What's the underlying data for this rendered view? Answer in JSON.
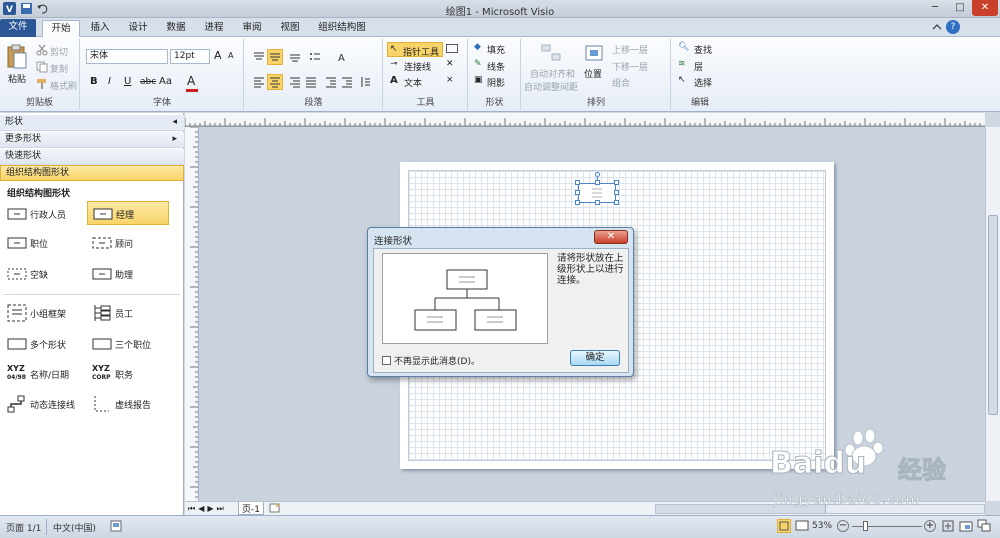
{
  "app": {
    "title": "绘图1 - Microsoft Visio"
  },
  "tabs": [
    {
      "label": "文件"
    },
    {
      "label": "开始"
    },
    {
      "label": "插入"
    },
    {
      "label": "设计"
    },
    {
      "label": "数据"
    },
    {
      "label": "进程"
    },
    {
      "label": "审阅"
    },
    {
      "label": "视图"
    },
    {
      "label": "组织结构图"
    }
  ],
  "ribbon": {
    "clipboard": {
      "paste": "粘贴",
      "cut": "剪切",
      "copy": "复制",
      "format_painter": "格式刷",
      "label": "剪贴板"
    },
    "font": {
      "name": "宋体",
      "size": "12pt",
      "label": "字体"
    },
    "paragraph": {
      "label": "段落"
    },
    "tools": {
      "pointer": "指针工具",
      "connector": "连接线",
      "text": "文本",
      "label": "工具"
    },
    "shape": {
      "fill": "填充",
      "line": "线条",
      "shadow": "阴影",
      "label": "形状"
    },
    "arrange": {
      "auto_align": "自动对齐和",
      "auto_space": "自动调整间距",
      "position": "位置",
      "bring_forward": "上移一层",
      "send_backward": "下移一层",
      "group": "组合",
      "label": "排列"
    },
    "editing": {
      "find": "查找",
      "layers": "层",
      "select": "选择",
      "label": "编辑"
    }
  },
  "shapes_pane": {
    "title": "形状",
    "more_shapes": "更多形状",
    "quick_shapes": "快速形状",
    "org_chart_shapes": "组织结构图形状",
    "stencil_title": "组织结构图形状",
    "items": [
      {
        "label": "行政人员",
        "icon": "executive-shape-icon"
      },
      {
        "label": "经理",
        "icon": "manager-shape-icon"
      },
      {
        "label": "职位",
        "icon": "position-shape-icon"
      },
      {
        "label": "顾问",
        "icon": "consultant-shape-icon"
      },
      {
        "label": "空缺",
        "icon": "vacancy-shape-icon"
      },
      {
        "label": "助理",
        "icon": "assistant-shape-icon"
      },
      {
        "label": "小组框架",
        "icon": "team-frame-icon"
      },
      {
        "label": "员工",
        "icon": "staff-shape-icon"
      },
      {
        "label": "多个形状",
        "icon": "multiple-shapes-icon"
      },
      {
        "label": "三个职位",
        "icon": "three-positions-icon"
      },
      {
        "label": "名称/日期",
        "icon": "name-date-icon"
      },
      {
        "label": "职务",
        "icon": "title-shape-icon"
      },
      {
        "label": "动态连接线",
        "icon": "dynamic-connector-icon"
      },
      {
        "label": "虚线报告",
        "icon": "dotted-line-report-icon"
      }
    ],
    "name_date_glyph": {
      "top": "XYZ",
      "bottom": "04/98"
    },
    "title_glyph": {
      "top": "XYZ",
      "bottom": "CORP"
    }
  },
  "dialog": {
    "title": "连接形状",
    "message": "请将形状放在上级形状上以进行连接。",
    "checkbox": "不再显示此消息(D)。",
    "ok": "确定"
  },
  "page_tab": "页-1",
  "status": {
    "page": "页面 1/1",
    "language": "中文(中国)",
    "zoom": "53%"
  },
  "watermark": {
    "brand": "Baidu",
    "brand_cn": "经验",
    "url": "jingyan.baidu.com"
  },
  "colors": {
    "accent": "#2b5797",
    "selected": "#f8d468",
    "dialog_bg": "#d6e3f1"
  }
}
